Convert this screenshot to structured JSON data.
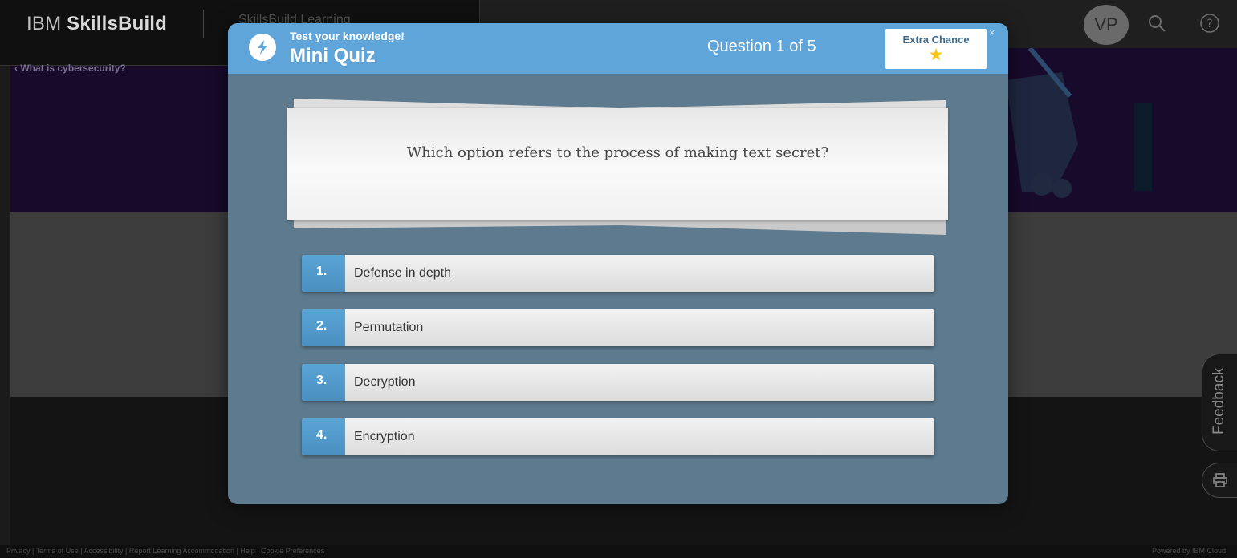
{
  "app": {
    "brand_regular": "IBM ",
    "brand_bold": "SkillsBuild",
    "subtitle": "SkillsBuild Learning",
    "avatar_initials": "VP",
    "back_link": "What is cybersecurity?",
    "feedback_label": "Feedback",
    "footer_left": "Privacy | Terms of Use | Accessibility | Report Learning Accommodation | Help | Cookie Preferences",
    "footer_right": "Powered by IBM Cloud"
  },
  "quiz": {
    "kicker": "Test your knowledge!",
    "title": "Mini Quiz",
    "progress": "Question 1 of 5",
    "extra_chance_label": "Extra Chance",
    "extra_chance_icon": "star-icon",
    "close": "×",
    "question": "Which option refers to the process of making text secret?",
    "options": [
      {
        "number": "1.",
        "text": "Defense in depth"
      },
      {
        "number": "2.",
        "text": "Permutation"
      },
      {
        "number": "3.",
        "text": "Decryption"
      },
      {
        "number": "4.",
        "text": "Encryption"
      }
    ]
  },
  "colors": {
    "header_blue": "#5fa5d9",
    "modal_body": "#5d7a8e",
    "option_number_blue": "#4a8fc0",
    "star": "#f5c518"
  }
}
